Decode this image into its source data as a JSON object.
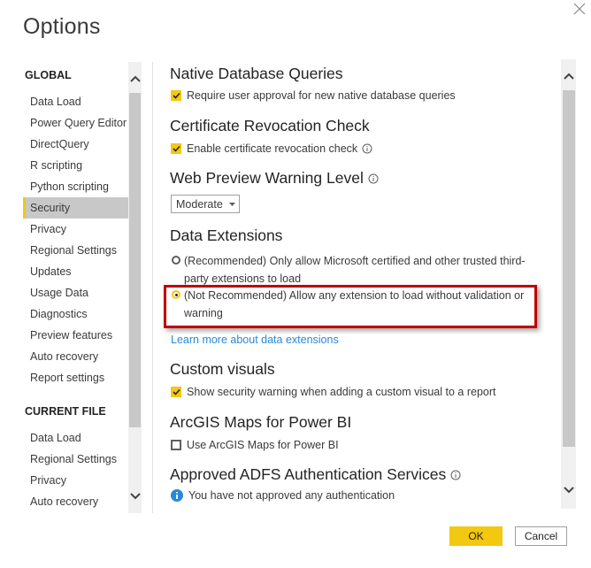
{
  "dialog": {
    "title": "Options",
    "close_icon": "close-icon"
  },
  "sidebar": {
    "global_heading": "GLOBAL",
    "global_items": [
      {
        "label": "Data Load"
      },
      {
        "label": "Power Query Editor"
      },
      {
        "label": "DirectQuery"
      },
      {
        "label": "R scripting"
      },
      {
        "label": "Python scripting"
      },
      {
        "label": "Security",
        "selected": true
      },
      {
        "label": "Privacy"
      },
      {
        "label": "Regional Settings"
      },
      {
        "label": "Updates"
      },
      {
        "label": "Usage Data"
      },
      {
        "label": "Diagnostics"
      },
      {
        "label": "Preview features"
      },
      {
        "label": "Auto recovery"
      },
      {
        "label": "Report settings"
      }
    ],
    "current_file_heading": "CURRENT FILE",
    "current_file_items": [
      {
        "label": "Data Load"
      },
      {
        "label": "Regional Settings"
      },
      {
        "label": "Privacy"
      },
      {
        "label": "Auto recovery"
      }
    ]
  },
  "main": {
    "native_db": {
      "title": "Native Database Queries",
      "option": {
        "label": "Require user approval for new native database queries",
        "checked": true
      }
    },
    "cert_revocation": {
      "title": "Certificate Revocation Check",
      "option": {
        "label": "Enable certificate revocation check",
        "checked": true
      }
    },
    "web_preview": {
      "title": "Web Preview Warning Level",
      "selected": "Moderate"
    },
    "data_extensions": {
      "title": "Data Extensions",
      "options": [
        {
          "label": "(Recommended) Only allow Microsoft certified and other trusted third-party extensions to load",
          "selected": false
        },
        {
          "label": "(Not Recommended) Allow any extension to load without validation or warning",
          "selected": true
        }
      ],
      "link": "Learn more about data extensions"
    },
    "custom_visuals": {
      "title": "Custom visuals",
      "option": {
        "label": "Show security warning when adding a custom visual to a report",
        "checked": true
      }
    },
    "arcgis": {
      "title": "ArcGIS Maps for Power BI",
      "option": {
        "label": "Use ArcGIS Maps for Power BI",
        "checked": false
      }
    },
    "adfs": {
      "title": "Approved ADFS Authentication Services",
      "message": "You have not approved any authentication"
    }
  },
  "footer": {
    "ok_label": "OK",
    "cancel_label": "Cancel"
  },
  "colors": {
    "accent": "#f2c811",
    "highlight_border": "#c00000",
    "link": "#2b88d8",
    "info": "#2b88d8"
  }
}
